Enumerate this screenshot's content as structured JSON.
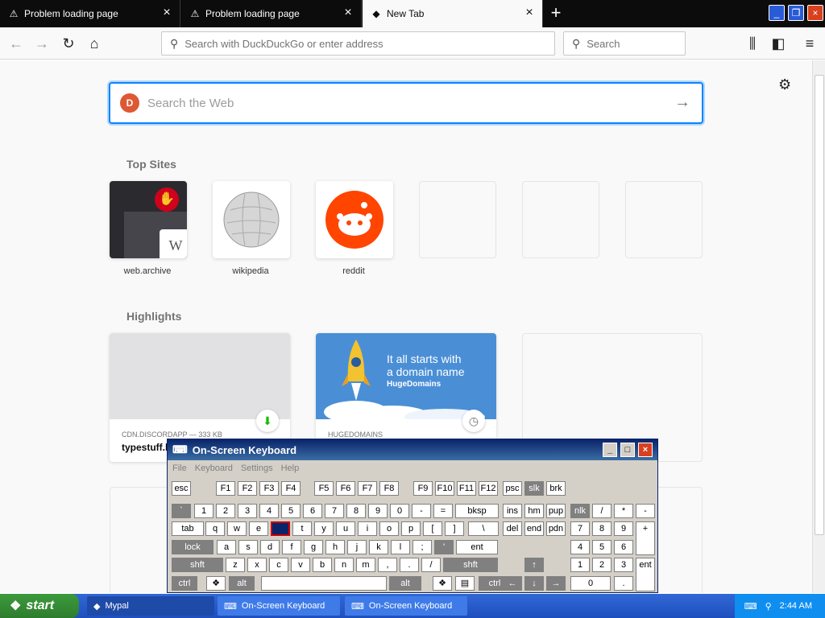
{
  "tabs": [
    {
      "label": "Problem loading page",
      "icon": "warning-icon"
    },
    {
      "label": "Problem loading page",
      "icon": "warning-icon"
    },
    {
      "label": "New Tab",
      "icon": "mypal-icon"
    }
  ],
  "urlbar": {
    "placeholder": "Search with DuckDuckGo or enter address"
  },
  "searchbar": {
    "placeholder": "Search"
  },
  "web_search": {
    "placeholder": "Search the Web"
  },
  "top_sites": {
    "title": "Top Sites",
    "sites": [
      {
        "label": "web.archive",
        "badge": "W"
      },
      {
        "label": "wikipedia"
      },
      {
        "label": "reddit"
      }
    ]
  },
  "highlights": {
    "title": "Highlights",
    "items": [
      {
        "meta": "CDN.DISCORDAPP — 333 KB",
        "title": "typestuff.l"
      },
      {
        "meta": "HUGEDOMAINS",
        "banner_line1": "It all starts with",
        "banner_line2": "a domain name",
        "banner_brand": "HugeDomains"
      }
    ]
  },
  "osk": {
    "title": "On-Screen Keyboard",
    "menu": [
      "File",
      "Keyboard",
      "Settings",
      "Help"
    ],
    "row0": [
      "esc",
      "F1",
      "F2",
      "F3",
      "F4",
      "F5",
      "F6",
      "F7",
      "F8",
      "F9",
      "F10",
      "F11",
      "F12",
      "psc",
      "slk",
      "brk"
    ],
    "row1": [
      "`",
      "1",
      "2",
      "3",
      "4",
      "5",
      "6",
      "7",
      "8",
      "9",
      "0",
      "-",
      "=",
      "bksp",
      "ins",
      "hm",
      "pup",
      "nlk",
      "/",
      "*",
      "-"
    ],
    "row2": [
      "tab",
      "q",
      "w",
      "e",
      "r",
      "t",
      "y",
      "u",
      "i",
      "o",
      "p",
      "[",
      "]",
      "\\",
      "del",
      "end",
      "pdn",
      "7",
      "8",
      "9",
      "+"
    ],
    "row3": [
      "lock",
      "a",
      "s",
      "d",
      "f",
      "g",
      "h",
      "j",
      "k",
      "l",
      ";",
      "'",
      "ent",
      "4",
      "5",
      "6"
    ],
    "row4": [
      "shft",
      "z",
      "x",
      "c",
      "v",
      "b",
      "n",
      "m",
      ",",
      ".",
      "/",
      "shft",
      "1",
      "2",
      "3",
      "ent"
    ],
    "row5": [
      "ctrl",
      "alt",
      "alt",
      "ctrl",
      "0",
      "."
    ]
  },
  "taskbar": {
    "start": "start",
    "tasks": [
      "Mypal",
      "On-Screen Keyboard",
      "On-Screen Keyboard"
    ],
    "clock": "2:44 AM"
  },
  "colors": {
    "accent": "#0a84ff",
    "reddit": "#ff4500",
    "hugedomains": "#4a8fd6",
    "ddg": "#de5833"
  }
}
